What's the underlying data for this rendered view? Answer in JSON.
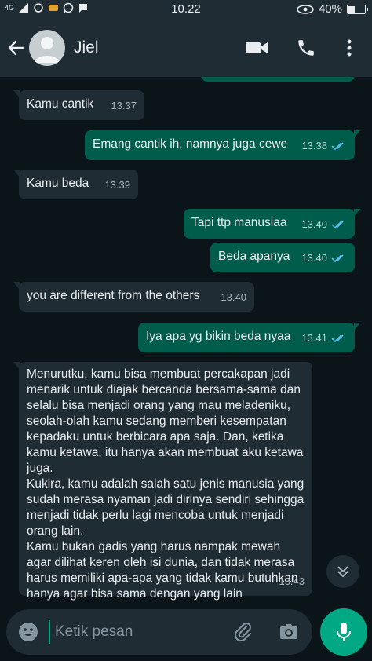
{
  "status_bar": {
    "time": "10.22",
    "battery": "40%",
    "battery_level": 0.4,
    "network": "4G"
  },
  "header": {
    "contact_name": "Jiel"
  },
  "messages": [
    {
      "direction": "in",
      "text": "Kamu cantik",
      "time": "13.37"
    },
    {
      "direction": "out",
      "text": "Emang cantik ih, namnya juga cewe",
      "time": "13.38",
      "read": true
    },
    {
      "direction": "in",
      "text": "Kamu beda",
      "time": "13.39"
    },
    {
      "direction": "out",
      "text": "Tapi ttp manusiaa",
      "time": "13.40",
      "read": true
    },
    {
      "direction": "out",
      "text": "Beda apanya",
      "time": "13.40",
      "read": true
    },
    {
      "direction": "in",
      "text": "you are different from the others",
      "time": "13.40"
    },
    {
      "direction": "out",
      "text": "Iya apa yg bikin beda nyaa",
      "time": "13.41",
      "read": true
    },
    {
      "direction": "in",
      "text": "Menurutku, kamu bisa membuat percakapan jadi menarik untuk diajak bercanda bersama-sama dan selalu bisa menjadi orang yang mau meladeniku, seolah-olah kamu sedang memberi kesempatan kepadaku untuk berbicara apa saja. Dan, ketika kamu ketawa, itu hanya akan membuat aku ketawa juga.\nKukira, kamu adalah salah satu jenis manusia yang sudah merasa nyaman jadi dirinya sendiri sehingga menjadi tidak perlu lagi mencoba untuk menjadi orang lain.\nKamu bukan gadis yang harus nampak mewah agar dilihat keren oleh isi dunia, dan tidak merasa harus memiliki apa-apa yang tidak kamu butuhkan hanya agar bisa sama dengan yang lain",
      "time": "13.43"
    }
  ],
  "composer": {
    "placeholder": "Ketik pesan"
  },
  "colors": {
    "incoming_bubble": "#1f2c34",
    "outgoing_bubble": "#005c4b",
    "accent": "#00a884",
    "read_ticks": "#53bdeb"
  }
}
